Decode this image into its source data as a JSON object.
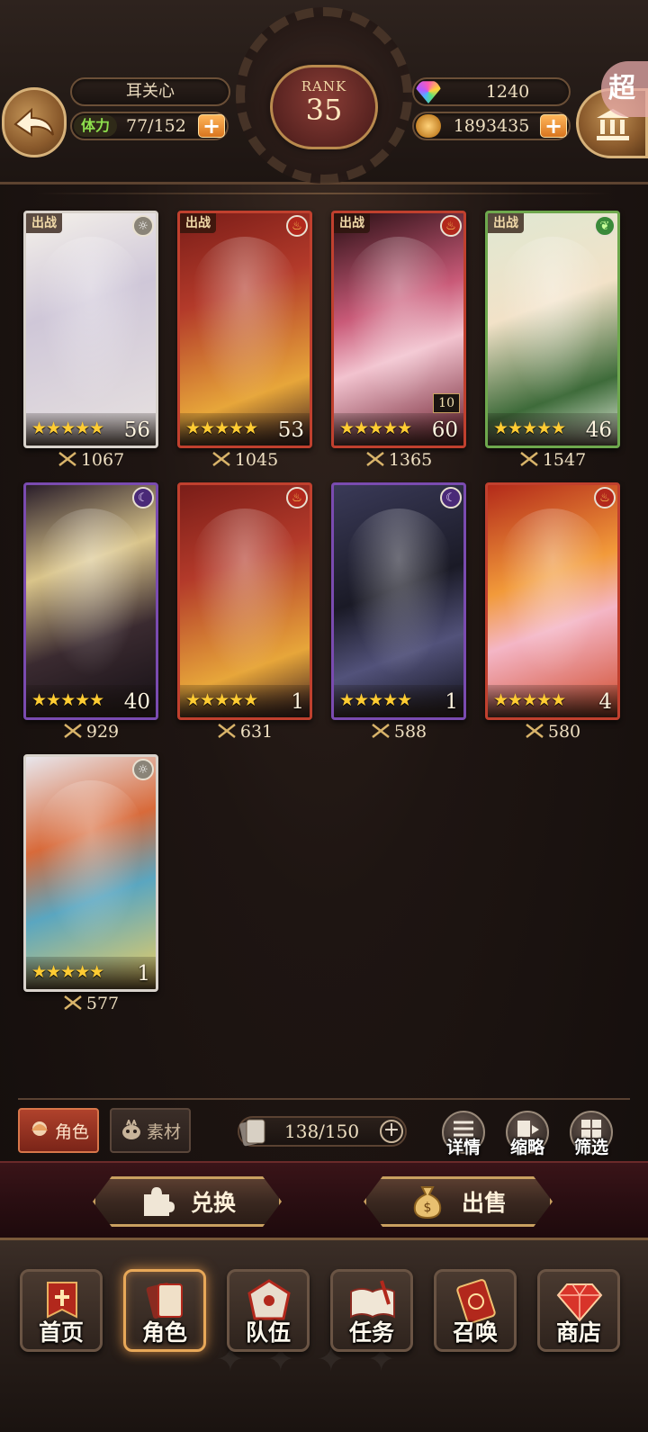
{
  "header": {
    "player_name": "耳关心",
    "stamina_label": "体力",
    "stamina_value": "77/152",
    "rank_label": "RANK",
    "rank_value": "35",
    "gems": "1240",
    "gold": "1893435",
    "corner_badge": "超"
  },
  "cards": [
    {
      "deployed": "出战",
      "element": "light",
      "stars": "★★★★★",
      "level": "56",
      "power": "1067"
    },
    {
      "deployed": "出战",
      "element": "fire",
      "stars": "★★★★★",
      "level": "53",
      "power": "1045"
    },
    {
      "deployed": "出战",
      "element": "fire",
      "stars": "★★★★★",
      "level": "60",
      "power": "1365",
      "badge": "10"
    },
    {
      "deployed": "出战",
      "element": "wood",
      "stars": "★★★★★",
      "level": "46",
      "power": "1547"
    },
    {
      "deployed": "",
      "element": "dark",
      "stars": "★★★★★",
      "level": "40",
      "power": "929"
    },
    {
      "deployed": "",
      "element": "fire",
      "stars": "★★★★★",
      "level": "1",
      "power": "631"
    },
    {
      "deployed": "",
      "element": "dark",
      "stars": "★★★★★",
      "level": "1",
      "power": "588"
    },
    {
      "deployed": "",
      "element": "fire",
      "stars": "★★★★★",
      "level": "4",
      "power": "580"
    },
    {
      "deployed": "",
      "element": "light",
      "stars": "★★★★★",
      "level": "1",
      "power": "577"
    }
  ],
  "toolbar": {
    "tab_role": "角色",
    "tab_material": "素材",
    "capacity": "138/150",
    "detail_label": "详情",
    "thumbnail_label": "缩略",
    "filter_label": "筛选"
  },
  "actions": {
    "exchange_label": "兑换",
    "sell_label": "出售"
  },
  "nav": {
    "items": [
      {
        "label": "首页",
        "icon": "home-banner-icon"
      },
      {
        "label": "角色",
        "icon": "character-card-icon",
        "active": true
      },
      {
        "label": "队伍",
        "icon": "team-shield-icon"
      },
      {
        "label": "任务",
        "icon": "quest-book-icon"
      },
      {
        "label": "召唤",
        "icon": "summon-card-icon"
      },
      {
        "label": "商店",
        "icon": "shop-gem-icon"
      }
    ]
  },
  "colors": {
    "fire": "#b2281c",
    "light": "#8a8478",
    "wood": "#3a8a3a",
    "dark": "#4a2a78",
    "accent_gold": "#c9a060"
  }
}
